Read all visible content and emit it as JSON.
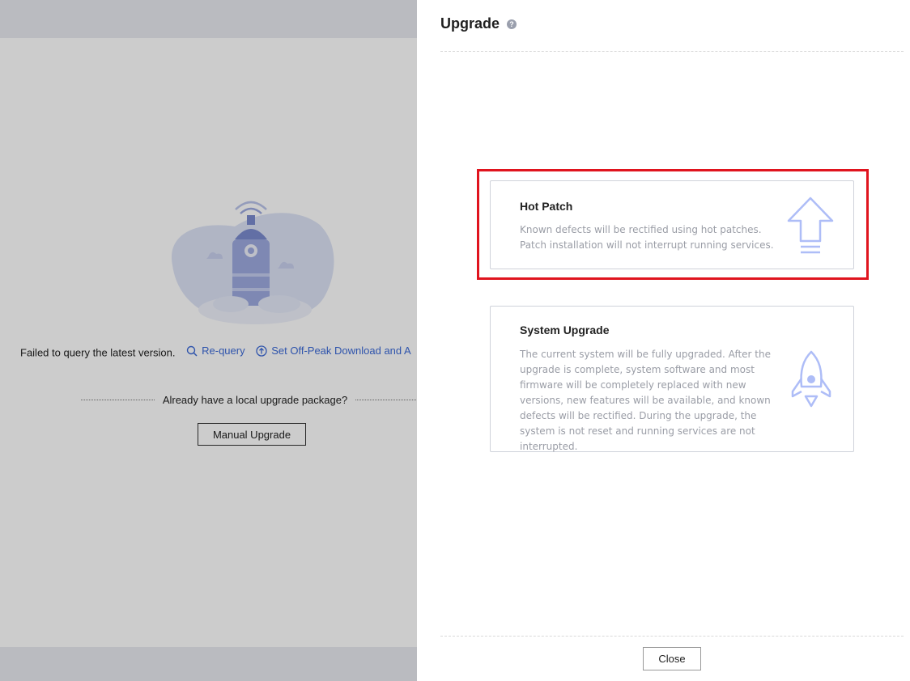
{
  "background": {
    "status_message": "Failed to query the latest version.",
    "requery_label": "Re-query",
    "offpeak_label": "Set Off-Peak Download and A",
    "local_package_text": "Already have a local upgrade package?",
    "manual_upgrade_label": "Manual Upgrade"
  },
  "drawer": {
    "title": "Upgrade",
    "help_glyph": "?",
    "cards": [
      {
        "title": "Hot Patch",
        "description": "Known defects will be rectified using hot patches. Patch installation will not interrupt running services.",
        "icon": "arrow-up-icon"
      },
      {
        "title": "System Upgrade",
        "description": "The current system will be fully upgraded. After the upgrade is complete, system software and most firmware will be completely replaced with new versions, new features will be available, and known defects will be rectified. During the upgrade, the system is not reset and running services are not interrupted.",
        "icon": "rocket-icon"
      }
    ],
    "close_label": "Close"
  },
  "colors": {
    "link": "#3b6ad8",
    "highlight": "#e0141e",
    "icon_blue": "#aebdf7"
  }
}
